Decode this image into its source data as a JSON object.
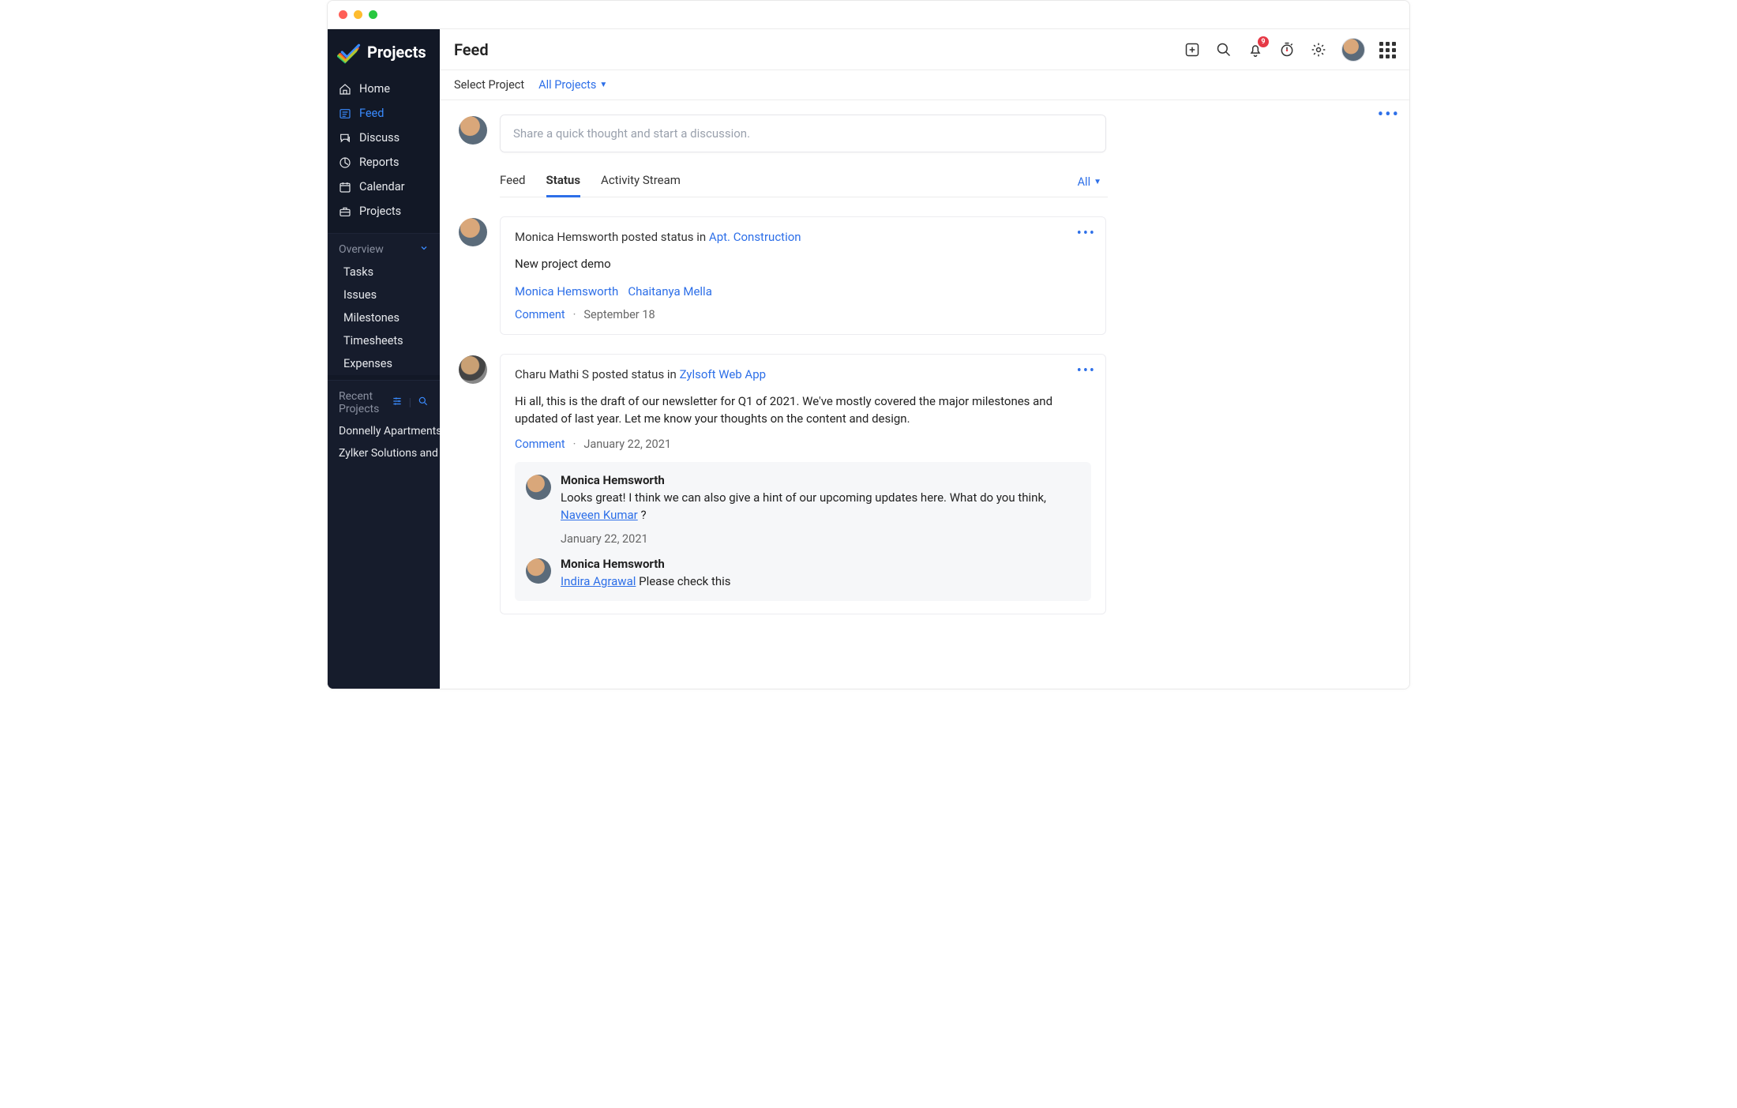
{
  "brand": {
    "name": "Projects"
  },
  "sidebar": {
    "nav": [
      {
        "label": "Home",
        "icon": "home"
      },
      {
        "label": "Feed",
        "icon": "feed",
        "active": true
      },
      {
        "label": "Discuss",
        "icon": "discuss"
      },
      {
        "label": "Reports",
        "icon": "reports"
      },
      {
        "label": "Calendar",
        "icon": "calendar"
      },
      {
        "label": "Projects",
        "icon": "projects"
      }
    ],
    "overview_header": "Overview",
    "overview_items": [
      "Tasks",
      "Issues",
      "Milestones",
      "Timesheets",
      "Expenses"
    ],
    "recent_header": "Recent Projects",
    "recent_items": [
      "Donnelly Apartments Const",
      "Zylker Solutions and Constr"
    ]
  },
  "topbar": {
    "title": "Feed",
    "notification_count": "9"
  },
  "contextbar": {
    "label": "Select Project",
    "selected": "All Projects"
  },
  "compose": {
    "placeholder": "Share a quick thought and start a discussion."
  },
  "tabs": {
    "items": [
      "Feed",
      "Status",
      "Activity Stream"
    ],
    "filter": "All"
  },
  "posts": [
    {
      "author": "Monica Hemsworth",
      "verb": "posted status in",
      "project": "Apt. Construction",
      "body": "New project demo",
      "mentions": [
        "Monica Hemsworth",
        "Chaitanya Mella"
      ],
      "comment_label": "Comment",
      "date": "September 18"
    },
    {
      "author": "Charu Mathi S",
      "verb": "posted status in",
      "project": "Zylsoft Web App",
      "body": "Hi all, this is the draft of our newsletter for Q1 of 2021. We've mostly covered the major milestones and updated of last year. Let me know your thoughts on the content and design.",
      "comment_label": "Comment",
      "date": "January 22, 2021",
      "replies": [
        {
          "author": "Monica Hemsworth",
          "body_prefix": "Looks great! I think we can also give a hint of our upcoming updates here. What do you think, ",
          "mention": "Naveen Kumar",
          "body_suffix": " ?",
          "date": "January 22, 2021"
        },
        {
          "author": "Monica Hemsworth",
          "mention": "Indira Agrawal",
          "body_suffix": " Please check this"
        }
      ]
    }
  ]
}
